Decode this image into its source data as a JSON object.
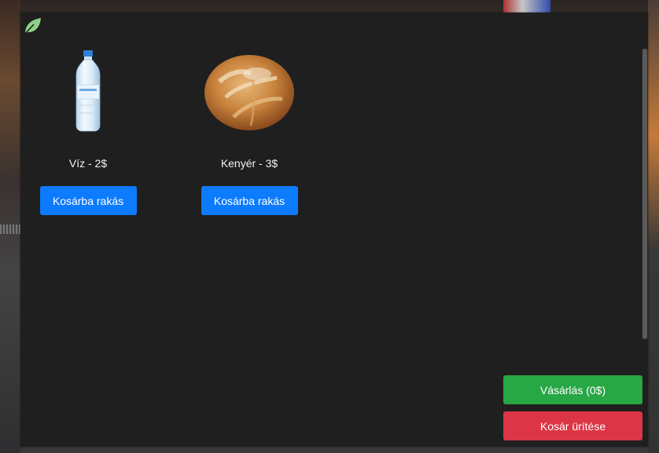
{
  "products": [
    {
      "icon": "water-bottle-icon",
      "name": "Víz - 2$",
      "button_label": "Kosárba rakás"
    },
    {
      "icon": "bread-icon",
      "name": "Kenyér - 3$",
      "button_label": "Kosárba rakás"
    }
  ],
  "cart": {
    "buy_label": "Vásárlás (0$)",
    "clear_label": "Kosár ürítése"
  },
  "colors": {
    "panel": "#1f1f1f",
    "add_button": "#0d7bfd",
    "buy_button": "#28a745",
    "clear_button": "#dc3545",
    "logo": "#8fd18a"
  }
}
